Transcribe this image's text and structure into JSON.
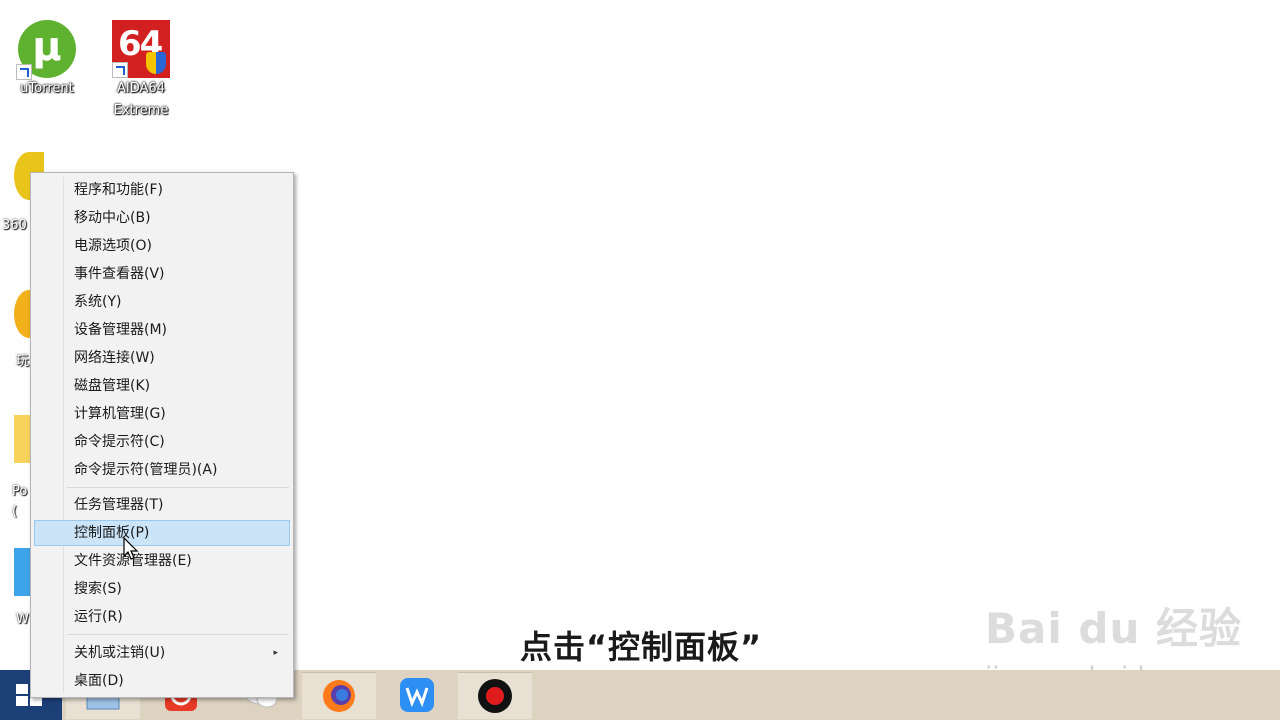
{
  "desktop": {
    "icons": [
      {
        "label": "uTorrent",
        "icon": "utorrent-icon"
      },
      {
        "label": "AIDA64\nExtreme",
        "icon": "aida64-icon",
        "glyph": "64"
      }
    ],
    "partial_labels": [
      "360",
      "玩",
      "Po\n(",
      "W"
    ]
  },
  "context_menu": {
    "group1": [
      "程序和功能(F)",
      "移动中心(B)",
      "电源选项(O)",
      "事件查看器(V)",
      "系统(Y)",
      "设备管理器(M)",
      "网络连接(W)",
      "磁盘管理(K)",
      "计算机管理(G)",
      "命令提示符(C)",
      "命令提示符(管理员)(A)"
    ],
    "group2": [
      "任务管理器(T)",
      "控制面板(P)",
      "文件资源管理器(E)",
      "搜索(S)",
      "运行(R)"
    ],
    "group3": [
      "关机或注销(U)",
      "桌面(D)"
    ],
    "highlighted_item": "控制面板(P)",
    "submenu_arrow": "▸"
  },
  "caption": "点击“控制面板”",
  "watermark": {
    "line1": "Bai du 经验",
    "line2": "jingyan.baidu.com"
  },
  "taskbar": {
    "buttons": [
      "file-explorer-icon",
      "360-icon",
      "chat-icon",
      "firefox-icon",
      "wps-icon",
      "record-icon"
    ]
  },
  "colors": {
    "taskbar": "#ddd3c0",
    "start": "#1c3f78",
    "highlight": "#cce4f7"
  }
}
